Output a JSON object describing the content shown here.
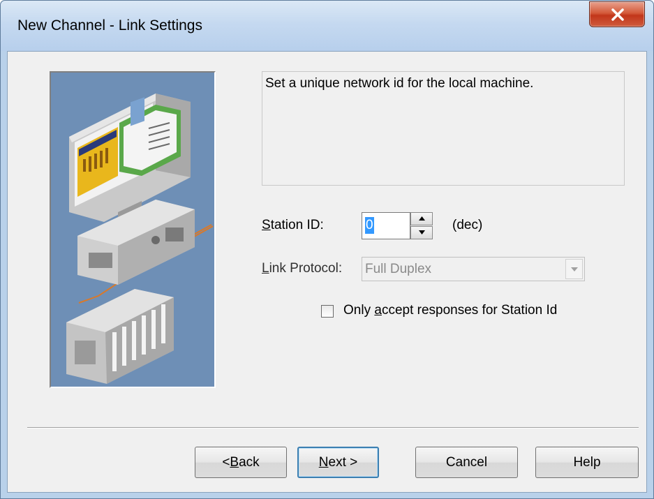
{
  "window": {
    "title": "New Channel - Link Settings"
  },
  "description": "Set a unique network id for the local machine.",
  "station_id": {
    "label_underlined": "S",
    "label_rest": "tation ID:",
    "value": "0",
    "unit": "(dec)"
  },
  "link_protocol": {
    "label_underlined": "L",
    "label_rest": "ink Protocol:",
    "value": "Full Duplex",
    "enabled": false
  },
  "only_accept": {
    "label_before": "Only ",
    "label_underlined": "a",
    "label_after": "ccept responses for Station Id",
    "checked": false
  },
  "buttons": {
    "back_prefix": "< ",
    "back_underlined": "B",
    "back_rest": "ack",
    "next_underlined": "N",
    "next_rest": "ext >",
    "cancel": "Cancel",
    "help": "Help"
  },
  "icons": {
    "close": "close-x-icon",
    "spin_up": "chevron-up-icon",
    "spin_down": "chevron-down-icon",
    "dropdown": "dropdown-arrow-icon",
    "illustration": "computer-plc-illustration"
  },
  "colors": {
    "title_bar": "#c5d9f0",
    "close_button": "#c2361a",
    "dialog_background": "#f0f0f0",
    "illustration_background": "#6e8fb6",
    "selection": "#3399ff",
    "default_button_border": "#3c7fb1"
  }
}
